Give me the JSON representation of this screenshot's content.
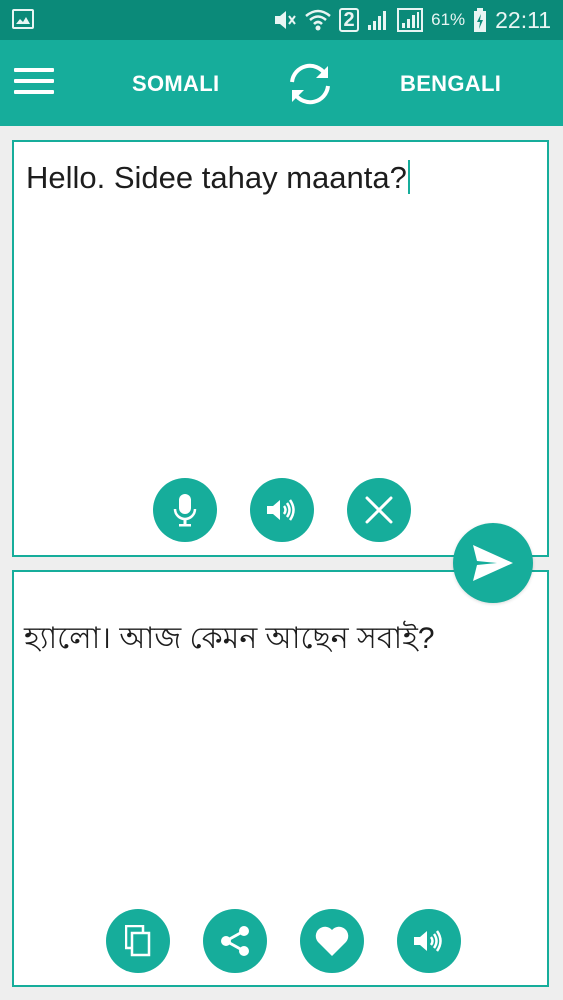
{
  "status_bar": {
    "sim_slot": "2",
    "battery_percent": "61%",
    "time": "22:11"
  },
  "app_bar": {
    "source_language": "SOMALI",
    "target_language": "BENGALI",
    "menu_icon": "menu-icon",
    "swap_icon": "swap-icon"
  },
  "source_panel": {
    "text": "Hello. Sidee tahay maanta?",
    "buttons": [
      "microphone-icon",
      "speaker-icon",
      "close-icon"
    ]
  },
  "target_panel": {
    "text": "হ্যালো। আজ কেমন আছেন সবাই?",
    "buttons": [
      "copy-icon",
      "share-icon",
      "heart-icon",
      "speaker-icon"
    ]
  },
  "send_icon": "send-icon",
  "colors": {
    "primary": "#16ad9b",
    "status_bar": "#0b8a79",
    "background": "#eeeeee"
  }
}
